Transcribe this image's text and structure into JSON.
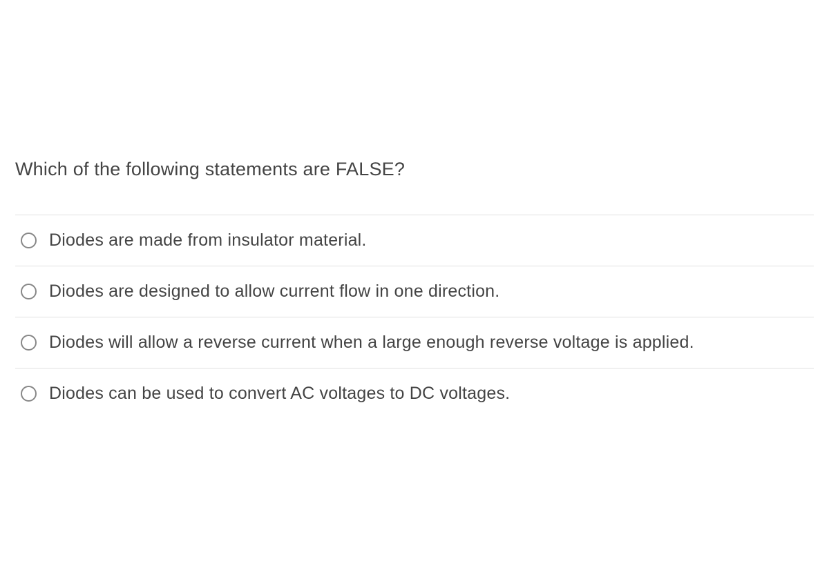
{
  "question": "Which of the following statements are FALSE?",
  "options": [
    "Diodes are made from insulator material.",
    "Diodes are designed to allow current flow in one direction.",
    "Diodes will allow a reverse current when a large enough reverse voltage is applied.",
    "Diodes can be used to convert AC voltages to DC voltages."
  ]
}
